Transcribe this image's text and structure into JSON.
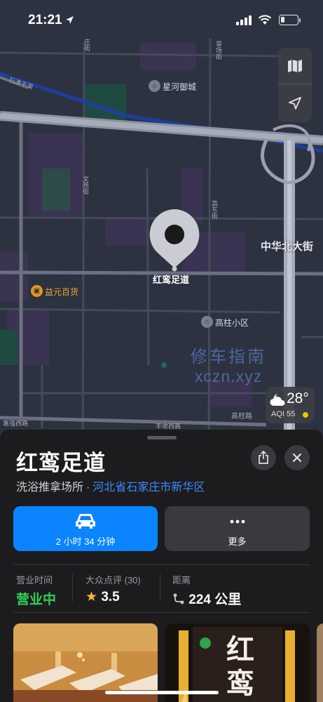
{
  "status_bar": {
    "time": "21:21"
  },
  "map": {
    "labels": {
      "xinghe": "星河御城",
      "zhonghua": "中华北大街",
      "yiyuan": "益元百货",
      "gaozhu_xiaoqu": "高柱小区",
      "gaozhu_road": "高柱路",
      "fengshou": "丰收西路",
      "shijin": "石津干渠",
      "wenyuan": "文苑街",
      "gaodong": "高东街",
      "caoyuan": "草场街",
      "zhuang": "庄街",
      "cangxi": "富强西路"
    },
    "pin_label": "红鸾足道",
    "watermark_line1": "修车指南",
    "watermark_line2": "xczn.xyz",
    "weather": {
      "temp": "28°",
      "aqi": "AQI 55"
    }
  },
  "sheet": {
    "title": "红鸾足道",
    "category": "洗浴推拿场所",
    "separator": "·",
    "address": "河北省石家庄市新华区",
    "drive_label": "2 小时 34 分钟",
    "more_label": "更多",
    "stats": {
      "hours_header": "营业时间",
      "hours_value": "营业中",
      "rating_header": "大众点评 (30)",
      "rating_value": "3.5",
      "distance_header": "距离",
      "distance_value": "224 公里"
    },
    "sign_text": "红鸾"
  },
  "colors": {
    "accent": "#0a84ff",
    "open": "#30d158",
    "star": "#ffb340",
    "map_bg": "#2d3240"
  }
}
